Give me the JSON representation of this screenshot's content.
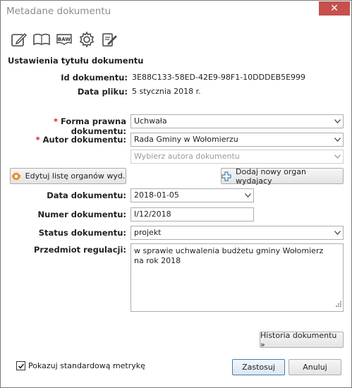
{
  "window": {
    "title": "Metadane dokumentu",
    "close_glyph": "✕"
  },
  "toolbar": [
    {
      "icon": "edit-icon"
    },
    {
      "icon": "book-icon"
    },
    {
      "icon": "baw-icon",
      "text": "BAW"
    },
    {
      "icon": "gear-icon"
    },
    {
      "icon": "sign-icon"
    }
  ],
  "section": {
    "title": "Ustawienia tytułu dokumentu"
  },
  "doc_info": {
    "id_label": "Id dokumentu:",
    "id_value": "3E88C133-58ED-42E9-98F1-10DDDEB5E999",
    "file_date_label": "Data pliku:",
    "file_date_value": "5 stycznia 2018 r."
  },
  "form": {
    "required_mark": "*",
    "legal_form": {
      "label": "Forma prawna dokumentu:",
      "value": "Uchwała"
    },
    "author": {
      "label": "Autor dokumentu:",
      "value": "Rada Gminy w Wołomierzu",
      "secondary_placeholder": "Wybierz autora dokumentu"
    },
    "edit_organs_button": "Edytuj listę organów wyd.",
    "add_organ_button": "Dodaj nowy organ wydajacy",
    "doc_date": {
      "label": "Data dokumentu:",
      "value": "2018-01-05"
    },
    "doc_number": {
      "label": "Numer dokumentu:",
      "value": "I/12/2018"
    },
    "status": {
      "label": "Status dokumentu:",
      "value": "projekt"
    },
    "subject": {
      "label": "Przedmiot regulacji:",
      "value": "w sprawie uchwalenia budżetu gminy Wołomierz na rok 2018"
    }
  },
  "footer": {
    "history_button": "Historia dokumentu »",
    "show_metric_label": "Pokazuj standardową metrykę",
    "show_metric_checked": true,
    "apply_button": "Zastosuj",
    "cancel_button": "Anuluj"
  },
  "colors": {
    "accent": "#3c7fb1",
    "required": "#d9251c",
    "close": "#c7504c",
    "gear_orange": "#e8891d"
  }
}
